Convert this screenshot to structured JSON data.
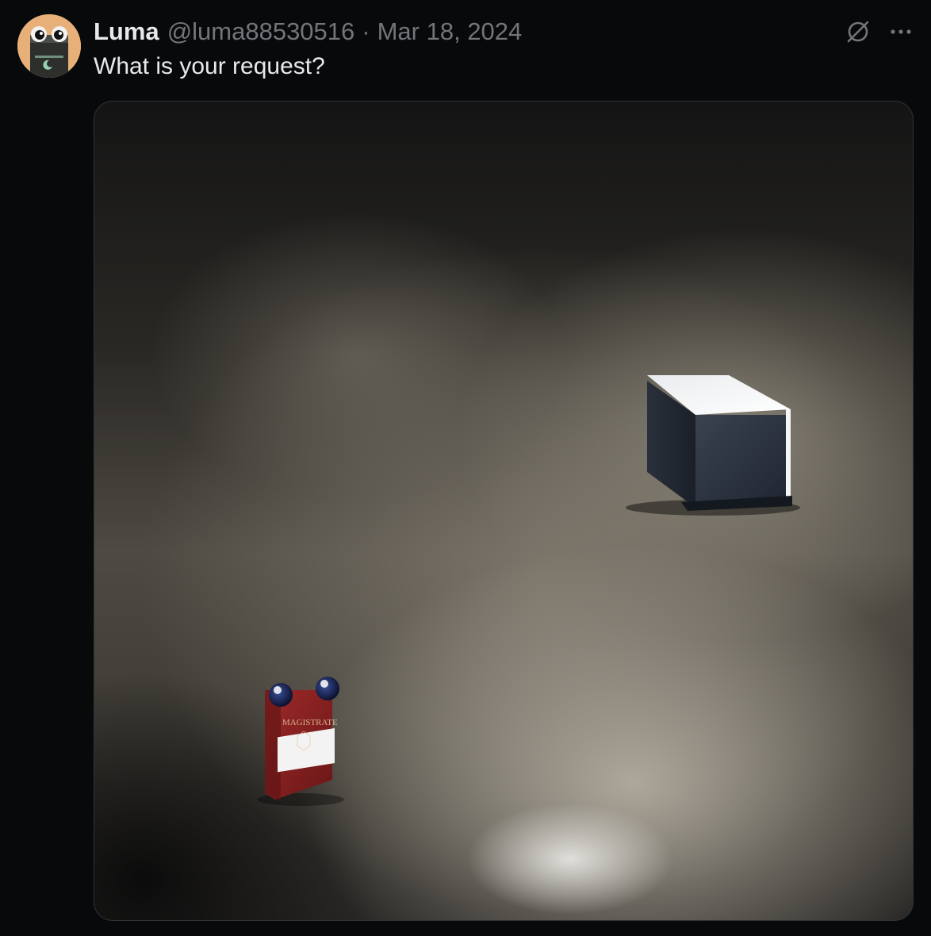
{
  "tweet": {
    "author_name": "Luma",
    "handle": "@luma88530516",
    "separator": "·",
    "date": "Mar 18, 2024",
    "text": "What is your request?",
    "grok_icon": "grok-icon",
    "more_icon": "more-dots-icon",
    "more_label": "···"
  },
  "media": {
    "pack_brand_text": "MAGISTRATE"
  },
  "colors": {
    "background": "#08090a",
    "primary_text": "#e7e9ea",
    "secondary_text": "#71767b",
    "border": "#2f3336",
    "avatar_bg": "#e8b079"
  }
}
